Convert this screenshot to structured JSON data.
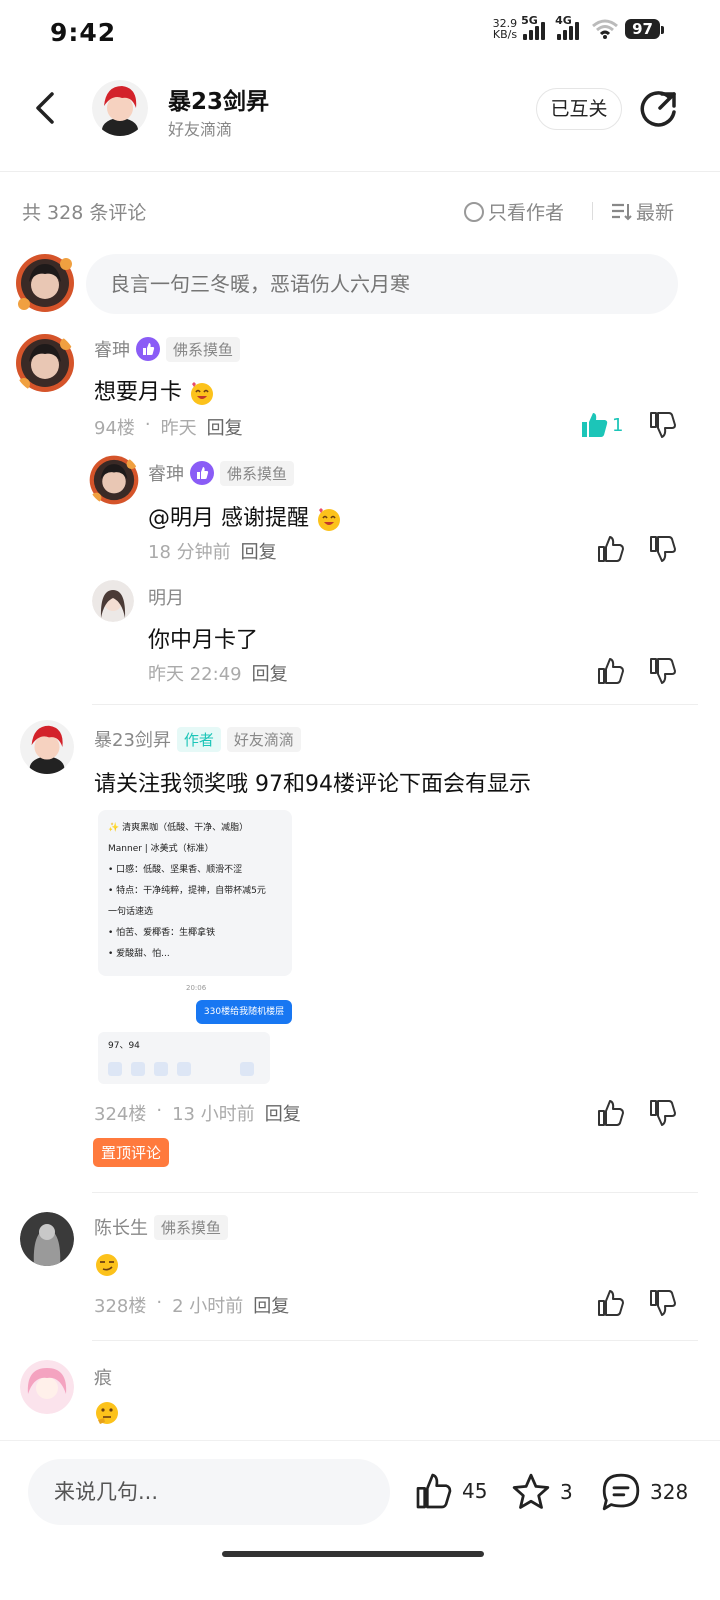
{
  "status_bar": {
    "time": "9:42",
    "net_speed_value": "32.9",
    "net_speed_unit": "KB/s",
    "signal1_label": "5G",
    "signal2_label": "4G",
    "battery": "97"
  },
  "header": {
    "name": "暴23剑昇",
    "subtitle": "好友滴滴",
    "follow_label": "已互关"
  },
  "comment_bar": {
    "count_text": "共 328 条评论",
    "author_only_label": "只看作者",
    "sort_label": "最新"
  },
  "comment_input": {
    "placeholder": "良言一句三冬暖，恶语伤人六月寒"
  },
  "comments": [
    {
      "name": "睿珅",
      "tag": "佛系摸鱼",
      "text": "想要月卡",
      "floor": "94楼",
      "time": "昨天",
      "reply_label": "回复",
      "likes": "1",
      "replies": [
        {
          "name": "睿珅",
          "tag": "佛系摸鱼",
          "text": "@明月  感谢提醒",
          "time": "18 分钟前",
          "reply_label": "回复"
        },
        {
          "name": "明月",
          "text": "你中月卡了",
          "time": "昨天 22:49",
          "reply_label": "回复"
        }
      ]
    },
    {
      "name": "暴23剑昇",
      "author_tag": "作者",
      "tag": "好友滴滴",
      "text": "请关注我领奖哦 97和94楼评论下面会有显示",
      "floor": "324楼",
      "time": "13 小时前",
      "reply_label": "回复",
      "pinned_label": "置顶评论",
      "image": {
        "lines": [
          "✨ 清爽黑咖（低酸、干净、减脂）",
          "Manner | 冰美式（标准）",
          "• 口感：低酸、坚果香、顺滑不涩",
          "• 特点：干净纯粹，提神，自带杯减5元",
          "一句话速选",
          "• 怕苦、爱椰香：生椰拿铁",
          "• 爱酸甜、怕..."
        ],
        "timestamp": "20:06",
        "bubble": "330楼给我随机楼层",
        "reply": "97、94"
      }
    },
    {
      "name": "陈长生",
      "tag": "佛系摸鱼",
      "floor": "328楼",
      "time": "2 小时前",
      "reply_label": "回复"
    },
    {
      "name": "痕"
    }
  ],
  "bottom_bar": {
    "input_placeholder": "来说几句...",
    "likes": "45",
    "favorites": "3",
    "comments": "328"
  },
  "colors": {
    "accent": "#1cc5b8",
    "level_badge": "#8a5cf6",
    "pinned": "#ff7a3d",
    "bubble": "#1877f2"
  }
}
